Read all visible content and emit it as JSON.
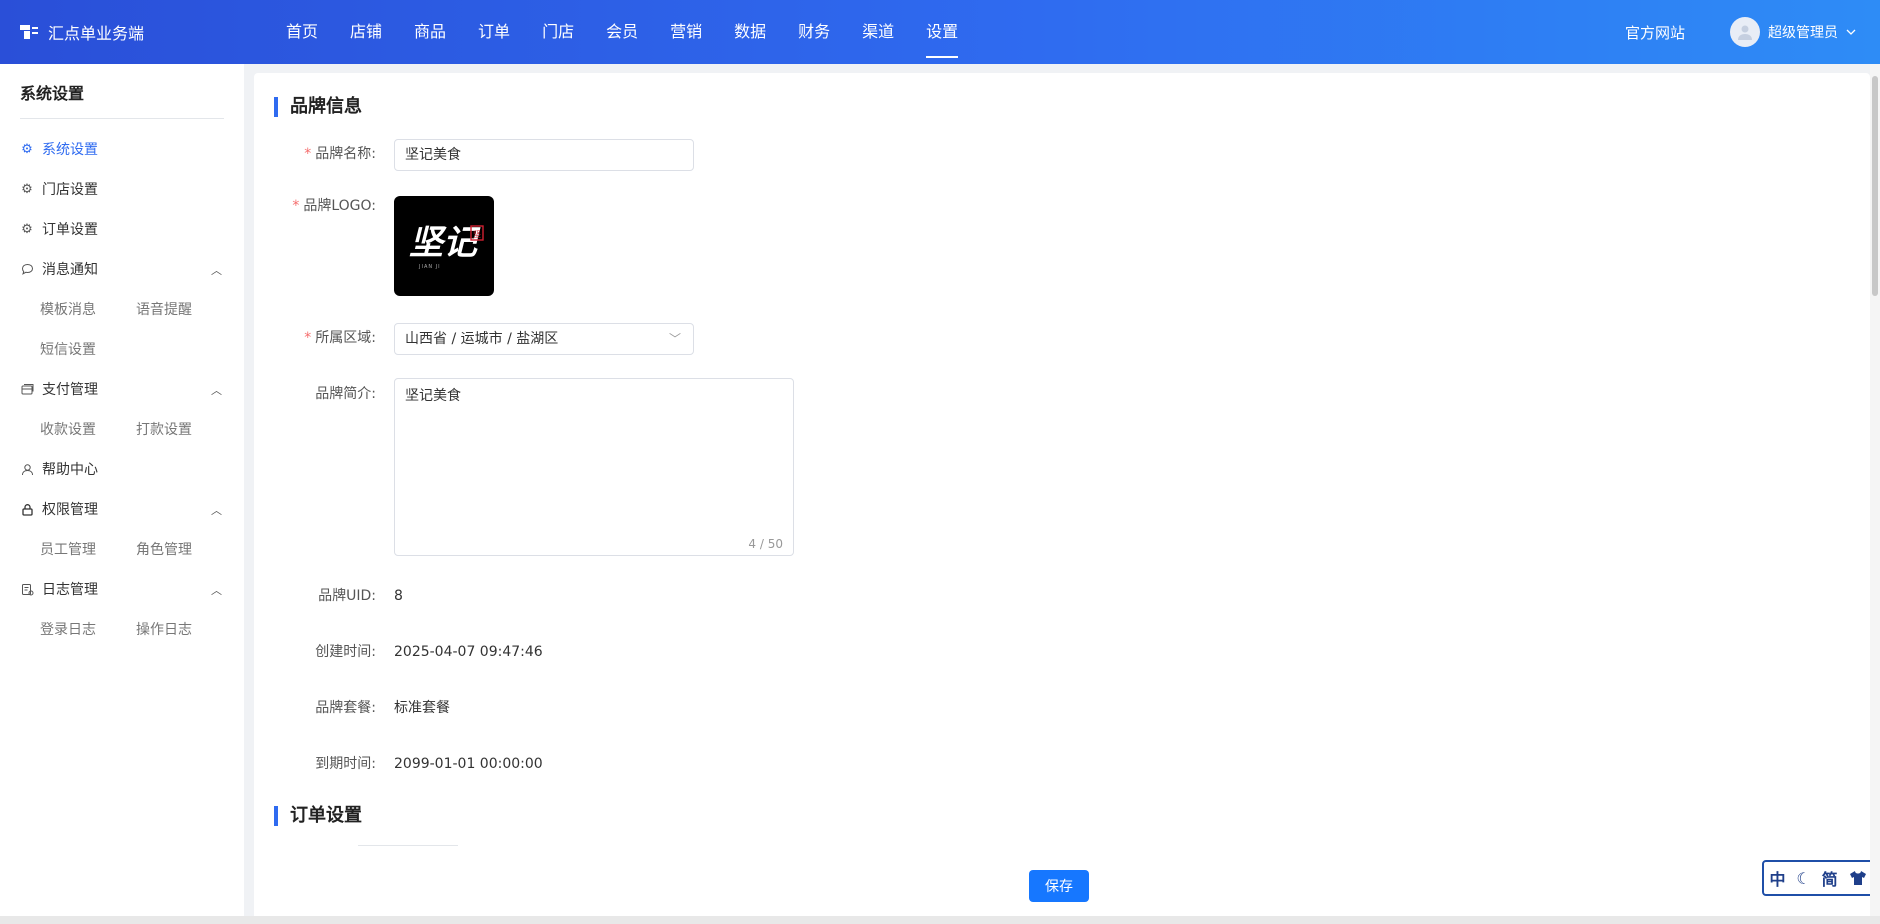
{
  "header": {
    "brand": "汇点单业务端",
    "nav": [
      "首页",
      "店铺",
      "商品",
      "订单",
      "门店",
      "会员",
      "营销",
      "数据",
      "财务",
      "渠道",
      "设置"
    ],
    "active_nav": "设置",
    "official_site": "官方网站",
    "user_name": "超级管理员"
  },
  "sidebar": {
    "title": "系统设置",
    "items": [
      {
        "label": "系统设置",
        "icon": "gear-icon",
        "active": true
      },
      {
        "label": "门店设置",
        "icon": "gear-icon"
      },
      {
        "label": "订单设置",
        "icon": "gear-icon"
      },
      {
        "label": "消息通知",
        "icon": "chat-icon",
        "expanded": true,
        "children": [
          "模板消息",
          "语音提醒",
          "短信设置"
        ]
      },
      {
        "label": "支付管理",
        "icon": "card-icon",
        "expanded": true,
        "children": [
          "收款设置",
          "打款设置"
        ]
      },
      {
        "label": "帮助中心",
        "icon": "user-icon"
      },
      {
        "label": "权限管理",
        "icon": "lock-icon",
        "expanded": true,
        "children": [
          "员工管理",
          "角色管理"
        ]
      },
      {
        "label": "日志管理",
        "icon": "log-icon",
        "expanded": true,
        "children": [
          "登录日志",
          "操作日志"
        ]
      }
    ]
  },
  "form": {
    "section_brand": "品牌信息",
    "brand_name_label": "品牌名称:",
    "brand_name_value": "坚记美食",
    "brand_logo_label": "品牌LOGO:",
    "region_label": "所属区域:",
    "region_value": "山西省 / 运城市 / 盐湖区",
    "intro_label": "品牌简介:",
    "intro_value": "坚记美食",
    "intro_count": "4 / 50",
    "uid_label": "品牌UID:",
    "uid_value": "8",
    "created_label": "创建时间:",
    "created_value": "2025-04-07 09:47:46",
    "package_label": "品牌套餐:",
    "package_value": "标准套餐",
    "expire_label": "到期时间:",
    "expire_value": "2099-01-01 00:00:00",
    "section_order": "订单设置",
    "save": "保存"
  },
  "logo": {
    "text": "坚记",
    "caption": "JIAN JI",
    "stamp": "坚"
  },
  "lang_widget": {
    "zh": "中",
    "simp": "简"
  },
  "colors": {
    "primary": "#2f6bf0",
    "button": "#1677ff",
    "required": "#f56c6c"
  }
}
